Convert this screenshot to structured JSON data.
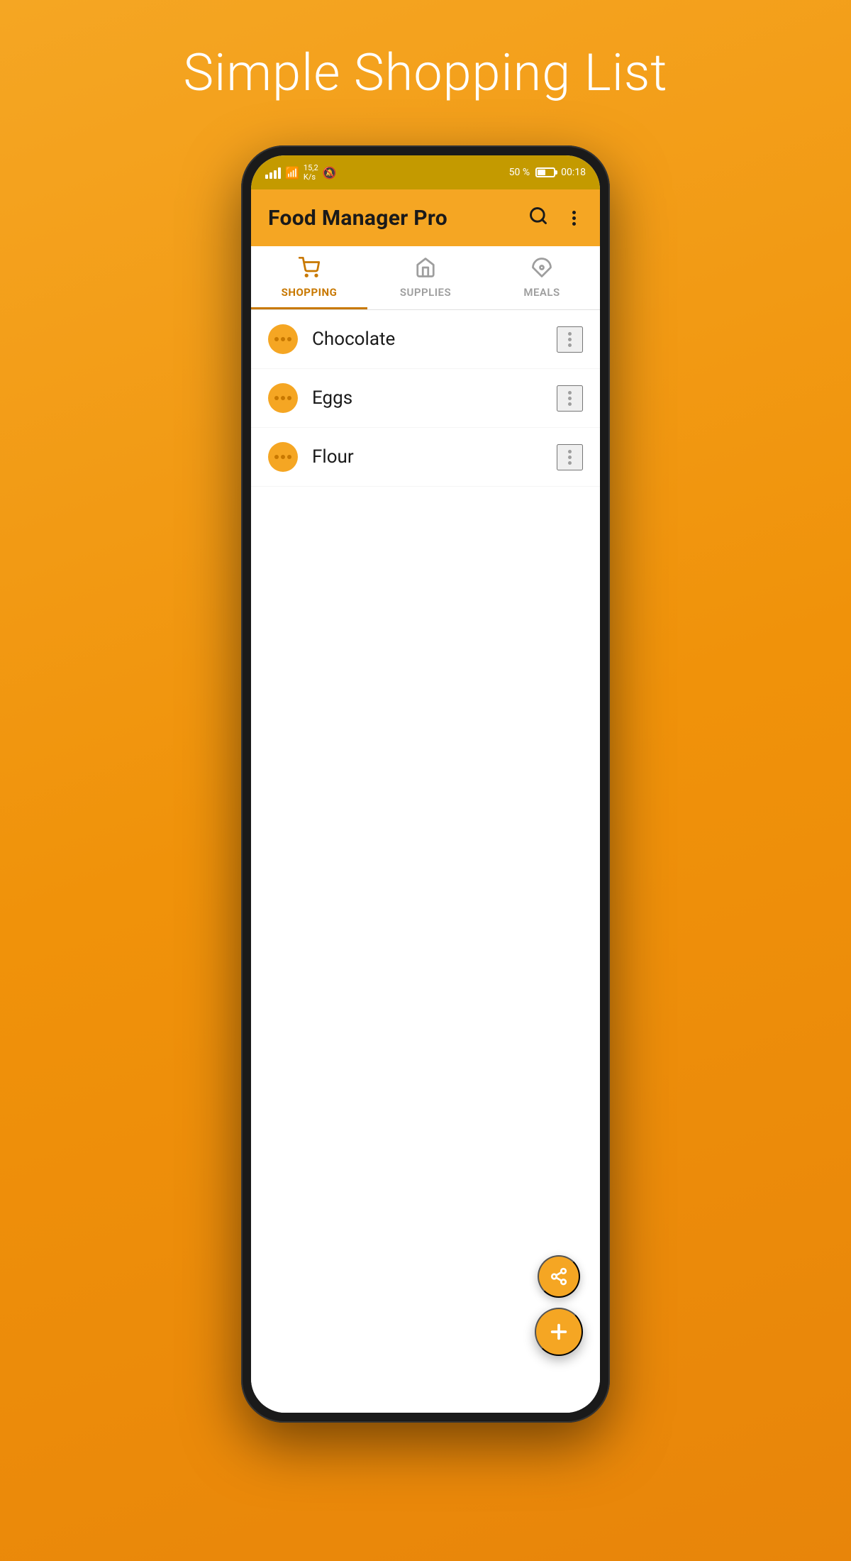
{
  "page": {
    "headline": "Simple Shopping List",
    "background_gradient_start": "#F5A623",
    "background_gradient_end": "#E8850A"
  },
  "status_bar": {
    "signal": "signal",
    "wifi": "wifi",
    "speed": "15,2\nK/s",
    "bell": "bell",
    "battery_percent": "50 %",
    "time": "00:18"
  },
  "app_bar": {
    "title": "Food Manager Pro",
    "search_label": "search",
    "menu_label": "more"
  },
  "tabs": [
    {
      "id": "shopping",
      "label": "SHOPPING",
      "icon": "cart",
      "active": true
    },
    {
      "id": "supplies",
      "label": "SUPPLIES",
      "icon": "store",
      "active": false
    },
    {
      "id": "meals",
      "label": "MEALS",
      "icon": "pizza",
      "active": false
    }
  ],
  "shopping_items": [
    {
      "id": 1,
      "name": "Chocolate"
    },
    {
      "id": 2,
      "name": "Eggs"
    },
    {
      "id": 3,
      "name": "Flour"
    }
  ],
  "fab": {
    "share_label": "share",
    "add_label": "add"
  }
}
